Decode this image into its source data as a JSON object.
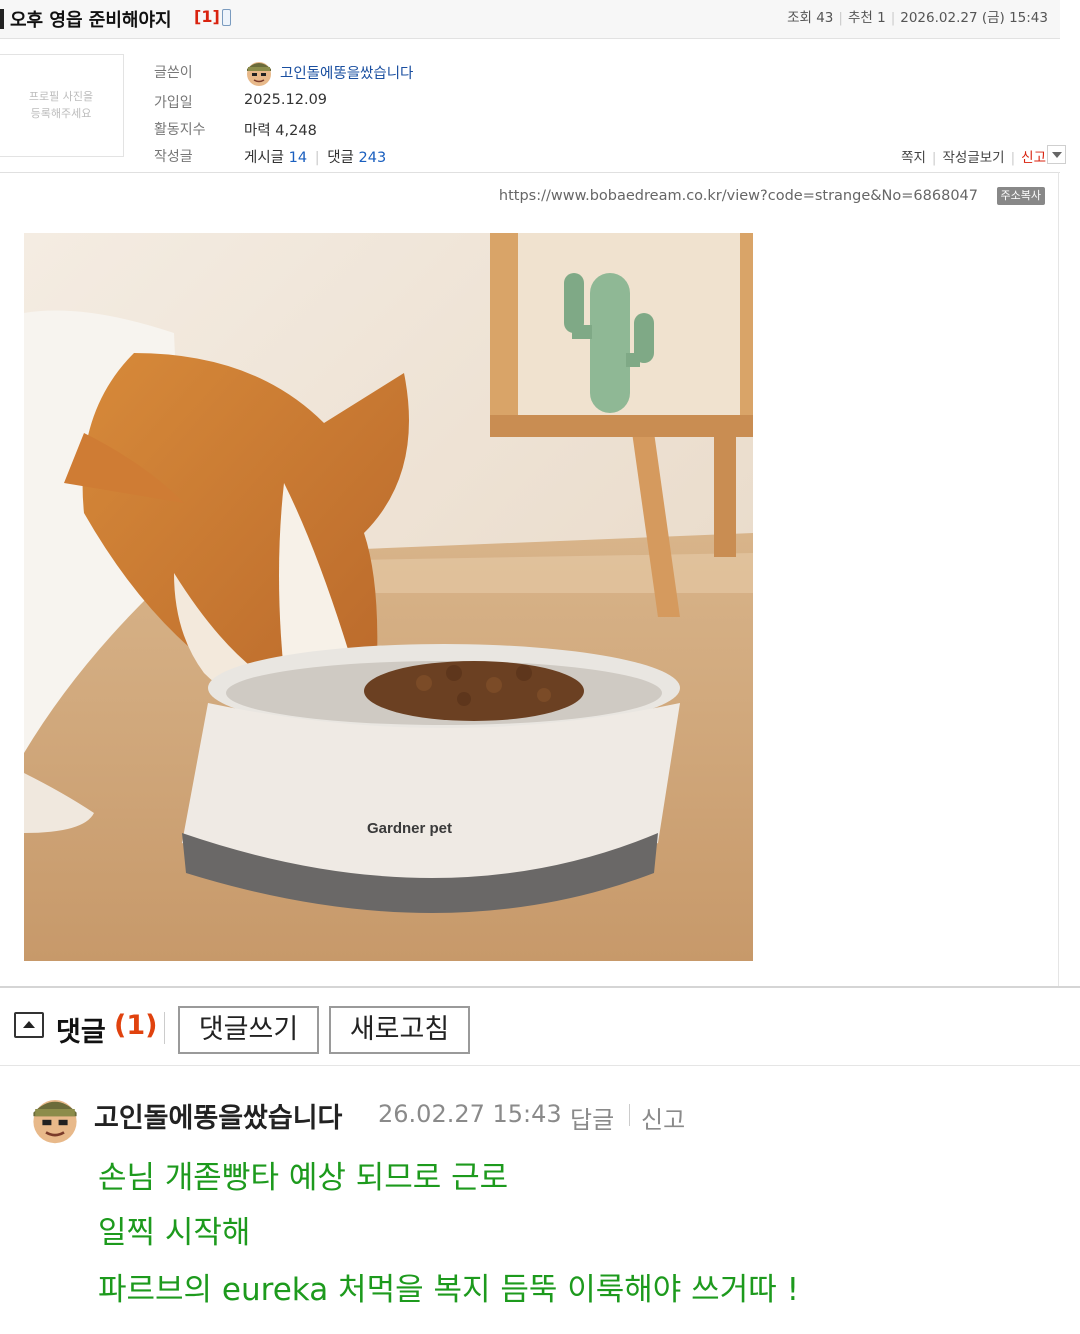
{
  "post": {
    "title": "오후 영읍 준비해야지",
    "comment_badge": "[1]",
    "views_label": "조회 43",
    "recommend_label": "추천 1",
    "datetime": "2026.02.27 (금) 15:43"
  },
  "author": {
    "profile_placeholder_line1": "프로필 사진을",
    "profile_placeholder_line2": "등록해주세요",
    "writer_label": "글쓴이",
    "writer_name": "고인돌에똥을쌌습니다",
    "joined_label": "가입일",
    "joined_value": "2025.12.09",
    "activity_label": "활동지수",
    "activity_value": "마력 4,248",
    "posts_label": "작성글",
    "posts_prefix": "게시글",
    "posts_count": "14",
    "comments_prefix": "댓글",
    "comments_count": "243",
    "actions": {
      "message": "쪽지",
      "view_posts": "작성글보기",
      "report": "신고"
    }
  },
  "url": {
    "text": "https://www.bobaedream.co.kr/view?code=strange&No=6868047",
    "copy_label": "주소복사"
  },
  "image": {
    "brand_text": "Gardner pet"
  },
  "comments_section": {
    "heading": "댓글",
    "count": "(1)",
    "write_label": "댓글쓰기",
    "refresh_label": "새로고침"
  },
  "comment": {
    "author": "고인돌에똥을쌌습니다",
    "date": "26.02.27 15:43",
    "reply_label": "답글",
    "report_label": "신고",
    "lines": [
      "손님 개졷빵타 예상 되므로 근로",
      "일찍 시작해",
      "파르브의 eureka 처먹을 복지 듬뚝 이룩해야 쓰거따 !"
    ]
  },
  "colors": {
    "accent_red": "#d9230f",
    "link_blue": "#1a5fbf",
    "comment_green": "#1d9a1d"
  }
}
